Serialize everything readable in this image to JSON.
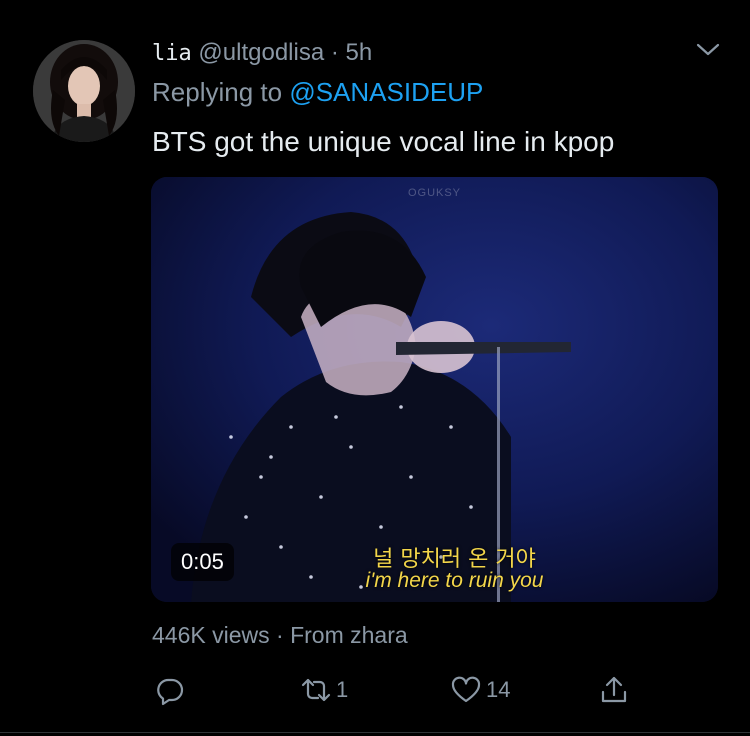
{
  "tweet": {
    "display_name": "lia",
    "handle": "@ultgodlisa",
    "separator": " · ",
    "time": "5h",
    "replying_label": "Replying to ",
    "replying_to": "@SANASIDEUP",
    "text": "BTS got the unique vocal line in kpop"
  },
  "media": {
    "watermark": "OGUKSY",
    "duration": "0:05",
    "subtitle_ko": "널 망치러 온 거야",
    "subtitle_en": "i'm here to ruin you"
  },
  "stats": {
    "views": "446K views",
    "separator": " · ",
    "source": "From zhara"
  },
  "actions": {
    "reply_count": "",
    "retweet_count": "1",
    "like_count": "14"
  },
  "colors": {
    "background": "#000000",
    "text_primary": "#e6ecf0",
    "text_secondary": "#8b98a5",
    "link": "#1da1f2",
    "subtitle": "#f3d64a"
  }
}
